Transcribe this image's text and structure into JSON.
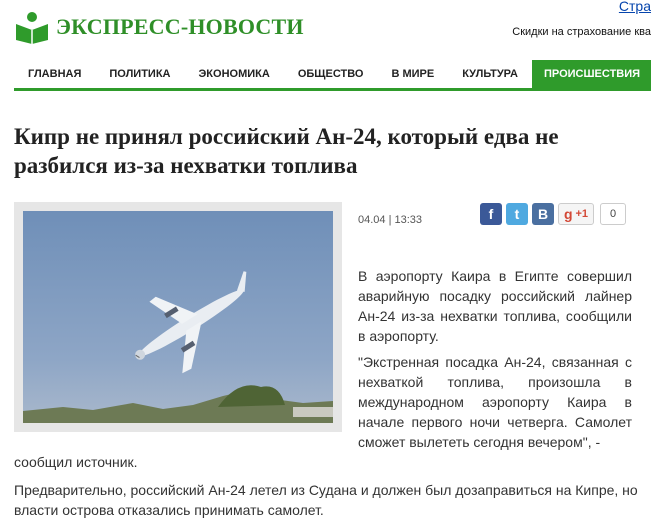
{
  "site": {
    "name": "ЭКСПРЕСС-НОВОСТИ",
    "top_link": "Стра",
    "ad_text": "Скидки на страхование ква"
  },
  "nav": {
    "items": [
      "ГЛАВНАЯ",
      "ПОЛИТИКА",
      "ЭКОНОМИКА",
      "ОБЩЕСТВО",
      "В МИРЕ",
      "КУЛЬТУРА"
    ],
    "active": "ПРОИСШЕСТВИЯ"
  },
  "colors": {
    "brand_green": "#2f9b2b",
    "facebook": "#3b5998",
    "twitter": "#4fa9e0",
    "vk": "#4a6fa0",
    "gplus": "#d34836"
  },
  "article": {
    "title": "Кипр не принял российский Ан-24, который едва не разбился из-за нехватки топлива",
    "date": "04.04 | 13:33",
    "share": {
      "fb_icon": "f",
      "tw_icon": "t",
      "vk_icon": "B",
      "gplus_icon": "g",
      "gplus_label": "+1",
      "count": "0"
    },
    "p1": "В аэропорту Каира в Египте совершил аварийную посадку российский лайнер Ан-24 из-за нехватки топлива, сообщили в аэропорту.",
    "p2_main": "\"Экстренная посадка Ан-24, связанная с нехваткой топлива, произошла в международном аэропорту Каира в начале первого ночи четверга. Самолет сможет вылететь сегодня вечером\", -",
    "p2_tail": "сообщил источник.",
    "p3": "Предварительно, российский Ан-24 летел из Судана и должен был дозаправиться на Кипре, но власти острова отказались принимать самолет."
  }
}
